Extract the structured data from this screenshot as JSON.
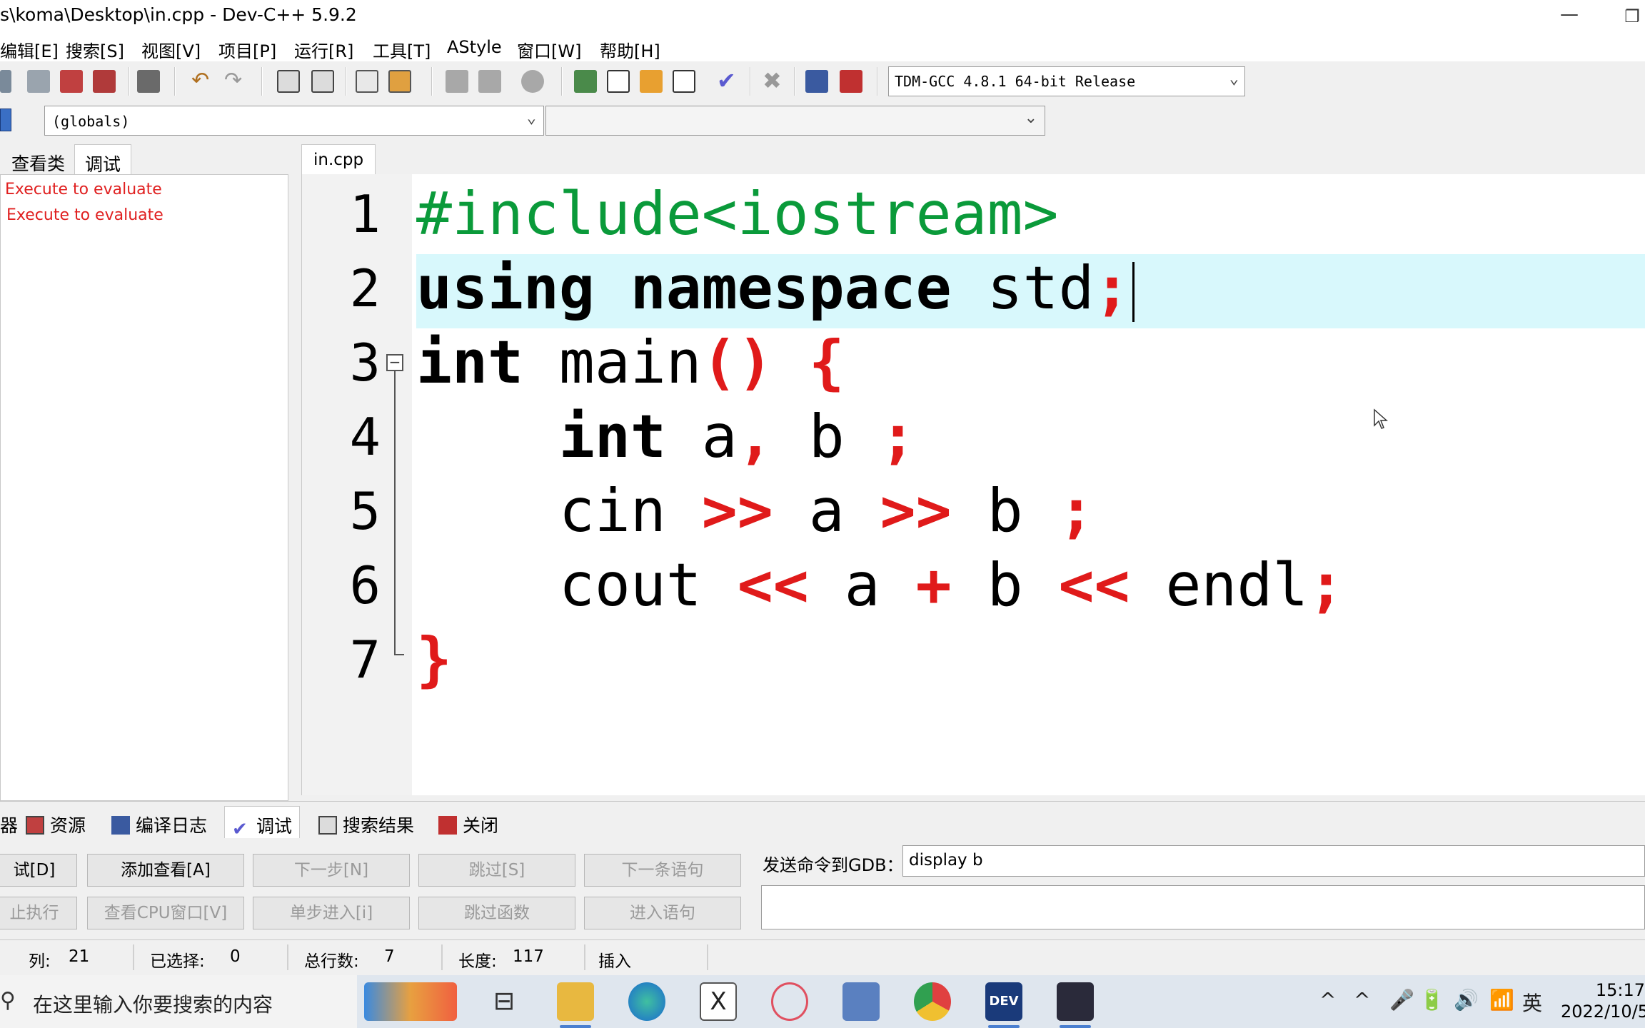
{
  "window": {
    "title": "s\\koma\\Desktop\\in.cpp - Dev-C++ 5.9.2",
    "minimize_glyph": "—",
    "restore_glyph": "❐"
  },
  "menu": [
    "编辑[E]",
    "搜索[S]",
    "视图[V]",
    "项目[P]",
    "运行[R]",
    "工具[T]",
    "AStyle",
    "窗口[W]",
    "帮助[H]"
  ],
  "toolbar": {
    "compiler": "TDM-GCC 4.8.1 64-bit Release",
    "icons": [
      "new-icon",
      "copy-icon",
      "close-file-icon",
      "close-all-icon",
      "print-icon",
      "undo-icon",
      "redo-icon",
      "find-icon",
      "replace-icon",
      "indent-icon",
      "unindent-icon",
      "bookmark-back-icon",
      "bookmark-forward-icon",
      "goto-icon",
      "compile-icon",
      "run-icon",
      "compile-run-icon",
      "rebuild-icon",
      "syntax-check-icon",
      "stop-icon",
      "profile-icon",
      "delete-profile-icon"
    ]
  },
  "classbar": {
    "scope": "(globals)",
    "members": ""
  },
  "left_panel": {
    "tabs": [
      "查看类",
      "调试"
    ],
    "active_tab": "调试",
    "watches": [
      "Execute to evaluate",
      "Execute to evaluate"
    ]
  },
  "editor": {
    "tab": "in.cpp",
    "line_numbers": [
      "1",
      "2",
      "3",
      "4",
      "5",
      "6",
      "7"
    ],
    "current_line": 2
  },
  "bottom_panel": {
    "tabs": [
      "器",
      "资源",
      "编译日志",
      "调试",
      "搜索结果",
      "关闭"
    ],
    "active_tab": "调试",
    "buttons_row1": [
      "试[D]",
      "添加查看[A]",
      "下一步[N]",
      "跳过[S]",
      "下一条语句"
    ],
    "buttons_row2": [
      "止执行",
      "查看CPU窗口[V]",
      "单步进入[i]",
      "跳过函数",
      "进入语句"
    ],
    "gdb_label": "发送命令到GDB：",
    "gdb_command": "display b",
    "gdb_output": ""
  },
  "status": {
    "col_label": "列:",
    "col_value": "21",
    "sel_label": "已选择:",
    "sel_value": "0",
    "lines_label": "总行数:",
    "lines_value": "7",
    "length_label": "长度:",
    "length_value": "117",
    "mode": "插入"
  },
  "taskbar": {
    "search_placeholder": "在这里输入你要搜索的内容",
    "apps": [
      "task-view-icon",
      "file-explorer-icon",
      "edge-icon",
      "excel-icon",
      "paint-icon",
      "network-app-icon",
      "chrome-icon",
      "devcpp-icon",
      "camera-app-icon"
    ],
    "tray": [
      "^",
      "^",
      "🎤",
      "🔋",
      "🔊",
      "📶",
      "英"
    ],
    "time": "15:17",
    "date": "2022/10/5"
  }
}
